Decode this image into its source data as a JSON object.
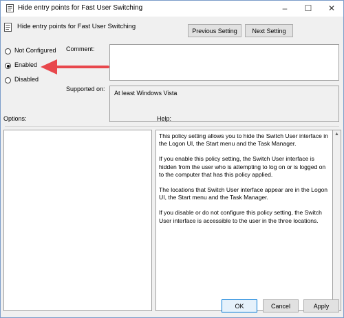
{
  "window": {
    "title": "Hide entry points for Fast User Switching",
    "min_glyph": "–",
    "max_glyph": "☐",
    "close_glyph": "✕"
  },
  "header": {
    "title": "Hide entry points for Fast User Switching",
    "prev_label": "Previous Setting",
    "next_label": "Next Setting"
  },
  "state": {
    "options": [
      "Not Configured",
      "Enabled",
      "Disabled"
    ],
    "selected": "Enabled"
  },
  "labels": {
    "comment": "Comment:",
    "supported_on": "Supported on:",
    "options": "Options:",
    "help": "Help:"
  },
  "supported_value": "At least Windows Vista",
  "help": {
    "paragraphs": [
      "This policy setting allows you to hide the Switch User interface in the Logon UI, the Start menu and the Task Manager.",
      "If you enable this policy setting, the Switch User interface is hidden from the user who is attempting to log on or is logged on to the computer that has this policy applied.",
      "The locations that Switch User interface appear are in the Logon UI, the Start menu and the Task Manager.",
      "If you disable or do not configure this policy setting, the Switch User interface is accessible to the user in the three locations."
    ]
  },
  "footer": {
    "ok": "OK",
    "cancel": "Cancel",
    "apply": "Apply"
  },
  "colors": {
    "annotation_arrow": "#e8474c",
    "ok_border": "#0078d7"
  },
  "icons": [
    "policy-icon",
    "minimize-icon",
    "maximize-icon",
    "close-icon",
    "scroll-up-icon",
    "scroll-down-icon",
    "annotation-arrow"
  ]
}
